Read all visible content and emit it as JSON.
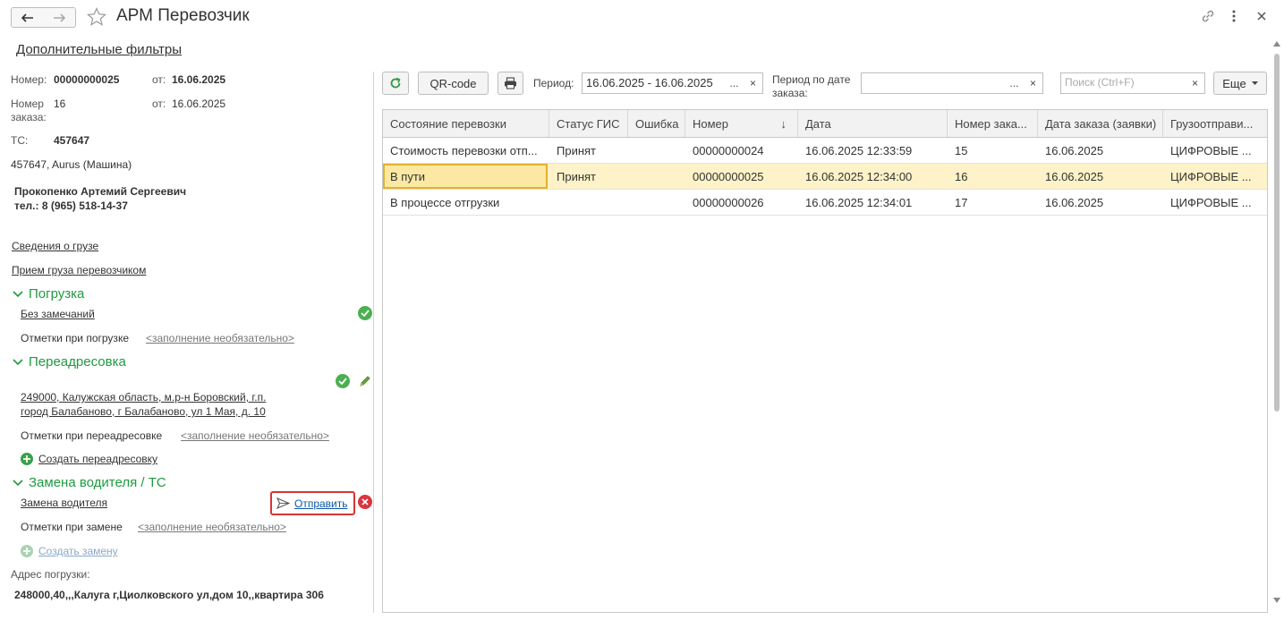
{
  "window": {
    "title": "АРМ Перевозчик"
  },
  "filters_link": "Дополнительные фильтры",
  "left": {
    "number_label": "Номер:",
    "number_value": "00000000025",
    "from_label": "от:",
    "from_value": "16.06.2025",
    "order_label": "Номер заказа:",
    "order_value": "16",
    "order_from_label": "от:",
    "order_from_value": "16.06.2025",
    "ts_label": "ТС:",
    "ts_value": "457647",
    "vehicle": "457647, Aurus (Машина)",
    "driver_name": "Прокопенко Артемий Сергеевич",
    "driver_phone": "тел.: 8 (965) 518-14-37",
    "cargo_info_link": "Сведения о грузе",
    "cargo_accept_link": "Прием груза перевозчиком",
    "loading": {
      "header": "Погрузка",
      "status_link": "Без замечаний",
      "notes_label": "Отметки при погрузке",
      "notes_value": "<заполнение необязательно>"
    },
    "redirect": {
      "header": "Переадресовка",
      "address_line1": "249000, Калужская область, м.р-н Боровский, г.п.",
      "address_line2": "город Балабаново, г Балабаново, ул 1 Мая, д. 10",
      "notes_label": "Отметки при переадресовке",
      "notes_value": "<заполнение необязательно>",
      "create_link": "Создать переадресовку"
    },
    "driver_change": {
      "header": "Замена водителя / ТС",
      "link": "Замена водителя",
      "send_label": "Отправить",
      "notes_label": "Отметки при замене",
      "notes_value": "<заполнение необязательно>",
      "create_link": "Создать замену"
    },
    "loading_address_label": "Адрес погрузки:",
    "loading_address_value": "248000,40,,,Калуга г,Циолковского ул,дом 10,,квартира 306"
  },
  "toolbar": {
    "qr_label": "QR-code",
    "period_label": "Период:",
    "period_value": "16.06.2025 - 16.06.2025",
    "period_dots": "...",
    "period_clear": "×",
    "order_period_label": "Период по дате заказа:",
    "order_period_value": "",
    "order_period_dots": "...",
    "order_period_clear": "×",
    "search_placeholder": "Поиск (Ctrl+F)",
    "search_clear": "×",
    "more_label": "Еще"
  },
  "grid": {
    "columns": [
      "Состояние перевозки",
      "Статус ГИС",
      "Ошибка",
      "Номер",
      "Дата",
      "Номер зака...",
      "Дата заказа (заявки)",
      "Грузоотправи..."
    ],
    "sort_indicator": "↓",
    "rows": [
      [
        "Стоимость перевозки отп...",
        "Принят",
        "",
        "00000000024",
        "16.06.2025 12:33:59",
        "15",
        "16.06.2025",
        "ЦИФРОВЫЕ ..."
      ],
      [
        "В пути",
        "Принят",
        "",
        "00000000025",
        "16.06.2025 12:34:00",
        "16",
        "16.06.2025",
        "ЦИФРОВЫЕ ..."
      ],
      [
        "В процессе отгрузки",
        "",
        "",
        "00000000026",
        "16.06.2025 12:34:01",
        "17",
        "16.06.2025",
        "ЦИФРОВЫЕ ..."
      ]
    ],
    "selected_row": 1
  },
  "colors": {
    "link": "#0b58a8",
    "section": "#1f9a3f",
    "ok": "#4caf50",
    "error": "#d9363e",
    "selection": "#fdf2c8"
  }
}
